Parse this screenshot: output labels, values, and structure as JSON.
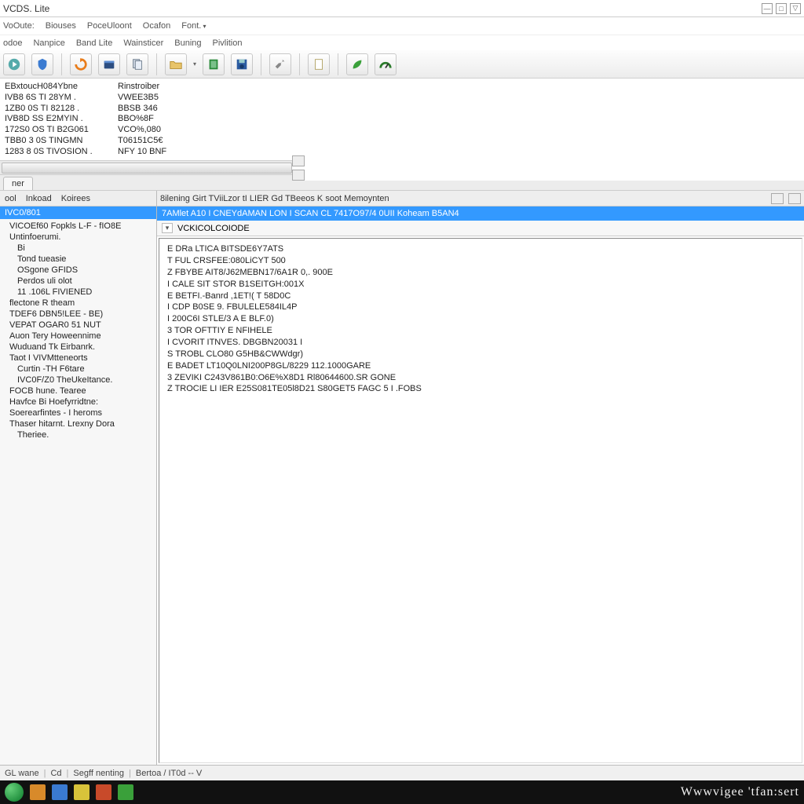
{
  "title": "VCDS. Lite",
  "menubar1": [
    "VoOute:",
    "Biouses",
    "PoceUloont",
    "Ocafon",
    "Font."
  ],
  "menubar2": [
    "odoe",
    "Nanpice",
    "Band Lite",
    "Wainsticer",
    "Buning",
    "Pivlition"
  ],
  "toolbar_icons": [
    "globe-play-icon",
    "shield-icon",
    "refresh-orange-icon",
    "box-blue-icon",
    "docs-icon",
    "folder-open-icon",
    "book-green-icon",
    "disk-blue-icon",
    "wrench-icon",
    "page-icon",
    "leaf-green-icon",
    "gauge-icon"
  ],
  "info": {
    "header": [
      "EBxtoucH084Ybne",
      "Rinstroiber"
    ],
    "rows": [
      [
        "IVB8 6S TI 28YM .",
        "VWEE3B5"
      ],
      [
        "1ZB0 0S TI 82128 .",
        "BBSB 346"
      ],
      [
        "IVB8D SS E2MYIN .",
        "BBO%8F"
      ],
      [
        "172S0 OS TI B2G061",
        "VCO%,080"
      ],
      [
        "TBB0 3 0S TINGMN",
        "T06151C5€"
      ],
      [
        "1283 8 0S TIVOSION .",
        "NFY 10 BNF"
      ]
    ]
  },
  "tab_ner": "ner",
  "left_panel": {
    "headers": [
      "ool",
      "Inkoad",
      "Koirees"
    ],
    "selected": "IVC0/801",
    "items": [
      "VICOEf60 Fopkls L-F - fIO8E",
      "Untinfoerumi.",
      "Bi",
      "Tond tueasie",
      "OSgone GFIDS",
      "Perdos uli olot",
      "11 .106L FIVIENED",
      "flectone R theam",
      "TDEF6 DBN5!LEE - BE)",
      "VEPAT OGAR0 51 NUT",
      "Auon Tery Howeennime",
      "Wuduand Tk Eirbanrk.",
      "Taot I VIVMtteneorts",
      "Curtin -TH F6tare",
      "IVC0F/Z0 TheUkeItance.",
      "FOCB hune. Tearee",
      "Havfce Bi Hoefyrridtne:",
      "Soerearfintes - I heroms",
      "Thaser hitarnt. Lrexny Dora",
      "Theriee."
    ]
  },
  "right_panel": {
    "tabs": "8ilening  Girt  TViiLzor tI LIER Gd TBeeos  K  soot  Memoynten",
    "selected": "7AMlet A10 I CNEYdAMAN LON I SCAN CL 7417O97/4 0UII Koheam B5AN4",
    "combo": "VCKICOLCOIODE",
    "lines": [
      "E  DRa LTICA BITSDE6Y7ATS",
      "T  FUL CRSFEE:080LiCYT 500",
      "Z  FBYBE AIT8/J62MEBN17/6A1R 0,. 900E",
      "I  CALE SIT STOR B1SEITGH:001X",
      "E  BETFI.-Banrd ,1ET!( T 58D0C",
      "I  CDP B0SE 9. FBULELE584IL4P",
      "I  200C6I STLE/3 A E BLF.0)",
      "3  TOR OFTTIY E NFIHELE",
      "I  CVORIT ITNVES. DBGBN20031 I",
      "S  TROBL CLO80 G5HB&CWWdgr)",
      "E  BADET LT10Q0LNI200P8GL/8229 112.1000GARE",
      "3  ZEVIKI C243V861B0:O6E%X8D1 Rl80644600.SR GONE",
      "Z  TROCIE LI IER E25S081TE05l8D21 S80GET5 FAGC 5 I .FOBS"
    ]
  },
  "statusbar": {
    "items": [
      "GL wane",
      "Cd",
      "Segff nenting",
      "Bertoa / IT0d -- V"
    ]
  },
  "brand": "Wwwvigee 'tfan:sert"
}
